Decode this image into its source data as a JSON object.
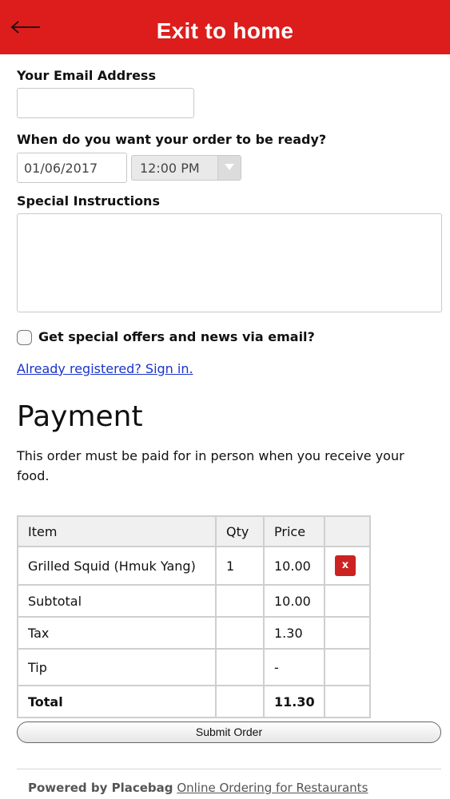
{
  "header": {
    "title": "Exit to home"
  },
  "form": {
    "email_label": "Your Email Address",
    "email_value": "",
    "ready_label": "When do you want your order to be ready?",
    "date_value": "01/06/2017",
    "time_value": "12:00 PM",
    "instructions_label": "Special Instructions",
    "instructions_value": "",
    "offers_label": "Get special offers and news via email?",
    "signin_link": "Already registered? Sign in."
  },
  "payment": {
    "title": "Payment",
    "note": "This order must be paid for in person when you receive your food."
  },
  "order_table": {
    "headers": [
      "Item",
      "Qty",
      "Price",
      ""
    ],
    "items": [
      {
        "name": "Grilled Squid (Hmuk Yang)",
        "qty": "1",
        "price": "10.00",
        "remove": "x"
      }
    ],
    "subtotal": {
      "label": "Subtotal",
      "value": "10.00"
    },
    "tax": {
      "label": "Tax",
      "value": "1.30"
    },
    "tip": {
      "label": "Tip",
      "value": "-"
    },
    "total": {
      "label": "Total",
      "value": "11.30"
    }
  },
  "submit_label": "Submit Order",
  "footer": {
    "prefix": "Powered by Placebag",
    "link": "Online Ordering for Restaurants"
  },
  "colors": {
    "header": "#dd1c1c",
    "link": "#1a33cc",
    "remove_button": "#cc2222"
  }
}
